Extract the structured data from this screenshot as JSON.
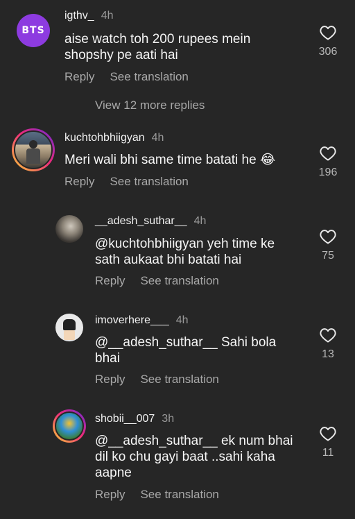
{
  "comments": [
    {
      "username": "igthv_",
      "time": "4h",
      "avatar_text": "BTS",
      "text_lines": [
        "aise watch toh 200 rupees mein",
        "shopshy pe aati hai"
      ],
      "likes": "306",
      "reply_label": "Reply",
      "translate_label": "See translation",
      "more_replies": "View 12 more replies"
    },
    {
      "username": "kuchtohbhiigyan",
      "time": "4h",
      "text_lines": [
        "Meri wali bhi same time batati he 😂"
      ],
      "likes": "196",
      "reply_label": "Reply",
      "translate_label": "See translation"
    },
    {
      "username": "__adesh_suthar__",
      "time": "4h",
      "text_lines": [
        "@kuchtohbhiigyan yeh time ke",
        "sath aukaat  bhi batati hai"
      ],
      "likes": "75",
      "reply_label": "Reply",
      "translate_label": "See translation"
    },
    {
      "username": "imoverhere___",
      "time": "4h",
      "text_lines": [
        "@__adesh_suthar__ Sahi bola",
        "bhai"
      ],
      "likes": "13",
      "reply_label": "Reply",
      "translate_label": "See translation"
    },
    {
      "username": "shobii__007",
      "time": "3h",
      "text_lines": [
        "@__adesh_suthar__ ek num bhai",
        "dil ko chu gayi baat ..sahi kaha",
        "aapne"
      ],
      "likes": "11",
      "reply_label": "Reply",
      "translate_label": "See translation"
    }
  ],
  "icons": {
    "like": "heart-outline-icon"
  },
  "colors": {
    "background": "#262626",
    "muted": "#a8a8a8",
    "avatar_purple": "#8d3be0"
  }
}
